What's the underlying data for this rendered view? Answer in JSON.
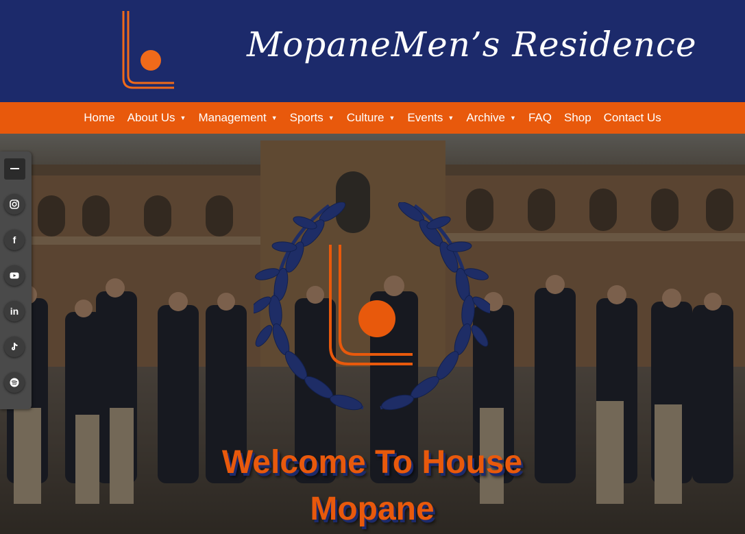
{
  "header": {
    "site_title": "MopaneMen’s Residence"
  },
  "nav": {
    "items": [
      {
        "label": "Home",
        "dropdown": false
      },
      {
        "label": "About Us",
        "dropdown": true
      },
      {
        "label": "Management",
        "dropdown": true
      },
      {
        "label": "Sports",
        "dropdown": true
      },
      {
        "label": "Culture",
        "dropdown": true
      },
      {
        "label": "Events",
        "dropdown": true
      },
      {
        "label": "Archive",
        "dropdown": true
      },
      {
        "label": "FAQ",
        "dropdown": false
      },
      {
        "label": "Shop",
        "dropdown": false
      },
      {
        "label": "Contact Us",
        "dropdown": false
      }
    ],
    "caret": "▼"
  },
  "hero": {
    "welcome_line1": "Welcome To House",
    "welcome_line2": "Mopane"
  },
  "social": {
    "icons": [
      "minus-icon",
      "instagram-icon",
      "facebook-icon",
      "youtube-icon",
      "linkedin-icon",
      "tiktok-icon",
      "spotify-icon"
    ],
    "linkedin_text": "in",
    "facebook_text": "f"
  },
  "colors": {
    "header_navy": "#1c2a6b",
    "nav_orange": "#e8590c",
    "logo_orange": "#f06a1a",
    "sidebar_gray": "#4a4a4a"
  }
}
